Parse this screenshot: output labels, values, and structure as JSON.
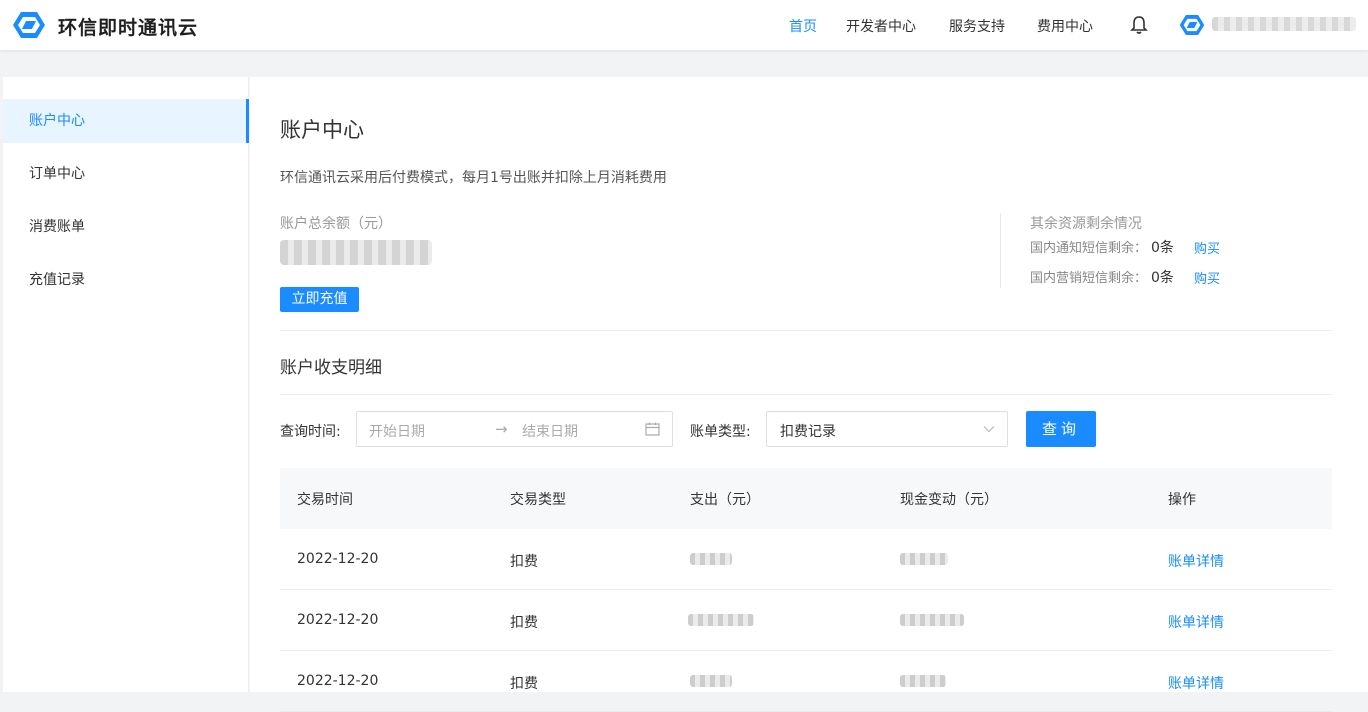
{
  "header": {
    "brand": "环信即时通讯云",
    "nav": [
      "首页",
      "开发者中心",
      "服务支持",
      "费用中心"
    ],
    "active_nav": "首页",
    "accent": "#1a8cff"
  },
  "sidebar": {
    "items": [
      {
        "label": "账户中心",
        "active": true
      },
      {
        "label": "订单中心",
        "active": false
      },
      {
        "label": "消费账单",
        "active": false
      },
      {
        "label": "充值记录",
        "active": false
      }
    ]
  },
  "main": {
    "title": "账户中心",
    "notice": "环信通讯云采用后付费模式，每月1号出账并扣除上月消耗费用",
    "balance_label": "账户总余额（元）",
    "recharge_label": "立即充值",
    "resources": {
      "title": "其余资源剩余情况",
      "rows": [
        {
          "label": "国内通知短信剩余：",
          "count": "0条",
          "buy": "购买"
        },
        {
          "label": "国内营销短信剩余：",
          "count": "0条",
          "buy": "购买"
        }
      ]
    },
    "section_title": "账户收支明细",
    "filter": {
      "time_label": "查询时间:",
      "start_placeholder": "开始日期",
      "arrow": "→",
      "end_placeholder": "结束日期",
      "type_label": "账单类型:",
      "type_value": "扣费记录",
      "query_label": "查询"
    },
    "table": {
      "columns": [
        "交易时间",
        "交易类型",
        "支出（元）",
        "现金变动（元）",
        "操作"
      ],
      "rows": [
        {
          "time": "2022-12-20",
          "type": "扣费",
          "action": "账单详情"
        },
        {
          "time": "2022-12-20",
          "type": "扣费",
          "action": "账单详情"
        },
        {
          "time": "2022-12-20",
          "type": "扣费",
          "action": "账单详情"
        }
      ]
    }
  }
}
